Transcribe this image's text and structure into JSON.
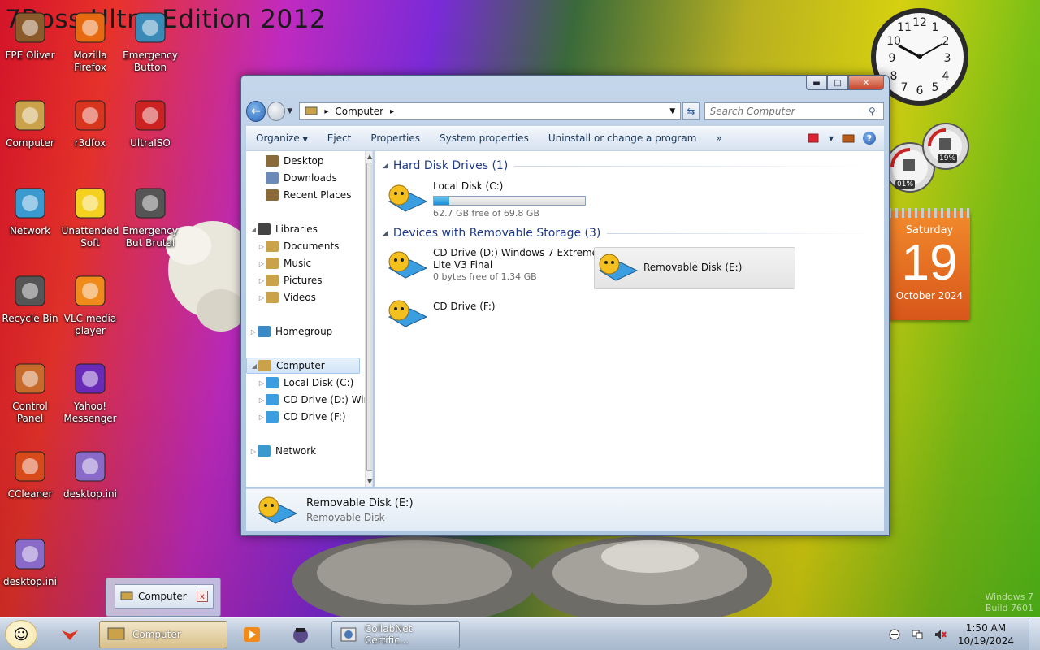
{
  "wallpaper": {
    "title": "7Boss Ultra Edition 2012",
    "watermark_line1": "Windows 7",
    "watermark_line2": "Build 7601"
  },
  "desktop_icons": [
    {
      "label": "FPE Oliver",
      "icon": "fpe-oliver-icon"
    },
    {
      "label": "Mozilla Firefox",
      "icon": "firefox-icon"
    },
    {
      "label": "Emergency Button",
      "icon": "emergency-button-icon"
    },
    {
      "label": "Computer",
      "icon": "computer-icon"
    },
    {
      "label": "r3dfox",
      "icon": "r3dfox-icon"
    },
    {
      "label": "UltraISO",
      "icon": "ultraiso-icon"
    },
    {
      "label": "Network",
      "icon": "network-icon"
    },
    {
      "label": "Unattended Soft",
      "icon": "star-icon"
    },
    {
      "label": "Emergency But Brutal",
      "icon": "emergency-brutal-icon"
    },
    {
      "label": "Recycle Bin",
      "icon": "recycle-bin-icon"
    },
    {
      "label": "VLC media player",
      "icon": "vlc-icon"
    },
    {
      "label": "Control Panel",
      "icon": "control-panel-icon"
    },
    {
      "label": "Yahoo! Messenger",
      "icon": "yahoo-messenger-icon"
    },
    {
      "label": "CCleaner",
      "icon": "ccleaner-icon"
    },
    {
      "label": "desktop.ini",
      "icon": "ini-file-icon"
    },
    {
      "label": "desktop.ini",
      "icon": "ini-file-icon"
    }
  ],
  "gadgets": {
    "calendar": {
      "weekday": "Saturday",
      "day": "19",
      "month_year": "October 2024"
    },
    "meter": {
      "cpu": "01%",
      "mem": "19%"
    }
  },
  "window": {
    "title": "Computer",
    "address": {
      "segment": "Computer"
    },
    "search_placeholder": "Search Computer",
    "toolbar": {
      "organize": "Organize",
      "eject": "Eject",
      "properties": "Properties",
      "system_properties": "System properties",
      "uninstall": "Uninstall or change a program",
      "more": "»"
    },
    "nav_pane": {
      "items": [
        {
          "label": "Desktop",
          "icon": "desktop-icon"
        },
        {
          "label": "Downloads",
          "icon": "downloads-icon"
        },
        {
          "label": "Recent Places",
          "icon": "recent-places-icon"
        },
        {
          "label": "Libraries",
          "icon": "libraries-icon"
        },
        {
          "label": "Documents",
          "icon": "documents-icon"
        },
        {
          "label": "Music",
          "icon": "music-icon"
        },
        {
          "label": "Pictures",
          "icon": "pictures-icon"
        },
        {
          "label": "Videos",
          "icon": "videos-icon"
        },
        {
          "label": "Homegroup",
          "icon": "homegroup-icon"
        },
        {
          "label": "Computer",
          "icon": "computer-icon"
        },
        {
          "label": "Local Disk (C:)",
          "icon": "drive-icon"
        },
        {
          "label": "CD Drive (D:) Wir",
          "icon": "drive-icon"
        },
        {
          "label": "CD Drive (F:)",
          "icon": "drive-icon"
        },
        {
          "label": "Network",
          "icon": "network-icon"
        }
      ]
    },
    "groups": {
      "hard_disks": "Hard Disk Drives (1)",
      "removable": "Devices with Removable Storage (3)"
    },
    "drives": {
      "c": {
        "name": "Local Disk (C:)",
        "free": "62.7 GB free of 69.8 GB",
        "used_fraction": 0.1
      },
      "d": {
        "name_line1": "CD Drive (D:) Windows 7 Extreme",
        "name_line2": "Lite V3 Final",
        "free": "0 bytes free of 1.34 GB"
      },
      "e": {
        "name": "Removable Disk (E:)"
      },
      "f": {
        "name": "CD Drive (F:)"
      }
    },
    "details": {
      "name": "Removable Disk (E:)",
      "type": "Removable Disk"
    }
  },
  "thumbnail_popup": {
    "label": "Computer",
    "close": "x"
  },
  "taskbar": {
    "apps": [
      {
        "label": "",
        "icon": "r3dfox-icon"
      },
      {
        "label": "Computer",
        "icon": "computer-icon"
      },
      {
        "label": "",
        "icon": "media-player-icon"
      },
      {
        "label": "",
        "icon": "fpe-oliver-icon"
      },
      {
        "label": "CollabNet Certific...",
        "icon": "collabnet-icon"
      }
    ],
    "time": "1:50 AM",
    "date": "10/19/2024"
  }
}
